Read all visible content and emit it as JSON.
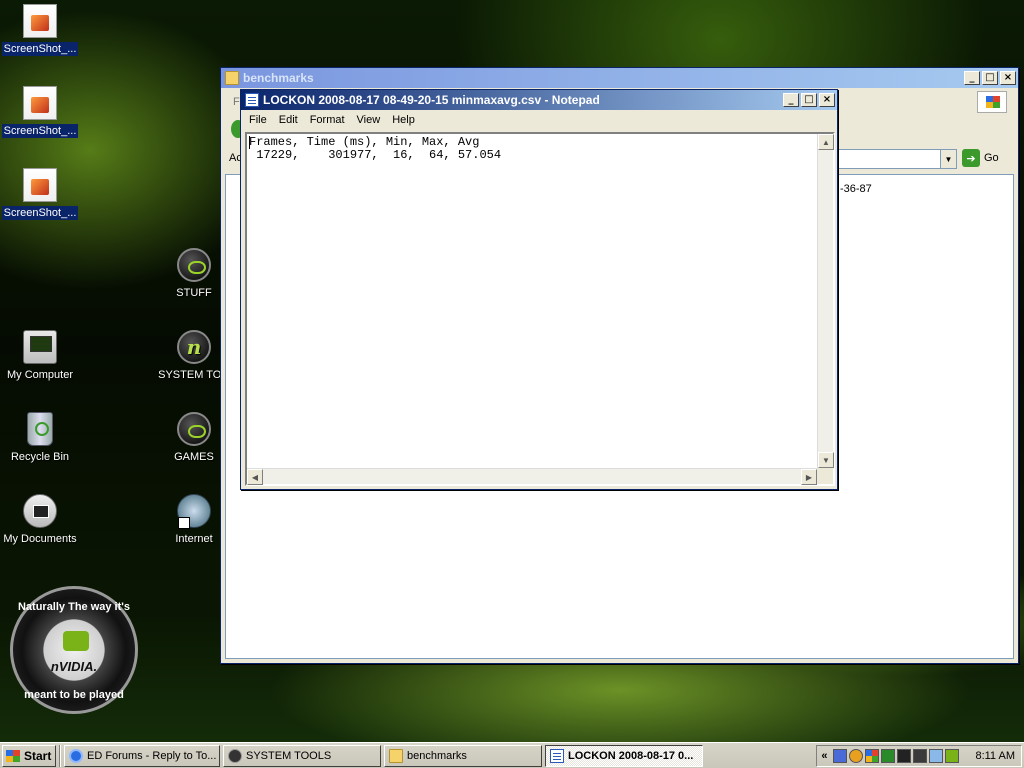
{
  "desktop": {
    "icons_left": [
      {
        "label": "ScreenShot_..."
      },
      {
        "label": "ScreenShot_..."
      },
      {
        "label": "ScreenShot_..."
      },
      {
        "label": "My Computer"
      },
      {
        "label": "Recycle Bin"
      },
      {
        "label": "My Documents"
      }
    ],
    "icons_right": [
      {
        "label": "STUFF"
      },
      {
        "label": "SYSTEM TOO"
      },
      {
        "label": "GAMES"
      },
      {
        "label": "Internet"
      }
    ],
    "badge": {
      "top": "Naturally The way it's",
      "brand": "nVIDIA.",
      "bottom": "meant to be played"
    }
  },
  "explorer": {
    "title": "benchmarks",
    "address_prefix": "Ac",
    "go_label": "Go",
    "file_fragment": "-36-87",
    "menu_fragment": "F"
  },
  "notepad": {
    "title": "LOCKON 2008-08-17 08-49-20-15 minmaxavg.csv - Notepad",
    "menu": [
      "File",
      "Edit",
      "Format",
      "View",
      "Help"
    ],
    "content": "Frames, Time (ms), Min, Max, Avg\n 17229,    301977,  16,  64, 57.054"
  },
  "taskbar": {
    "start": "Start",
    "buttons": [
      {
        "label": "ED Forums - Reply to To...",
        "active": false
      },
      {
        "label": "SYSTEM TOOLS",
        "active": false
      },
      {
        "label": "benchmarks",
        "active": false
      },
      {
        "label": "LOCKON 2008-08-17 0...",
        "active": true
      }
    ],
    "tray_chevron": "«",
    "clock": "8:11 AM"
  }
}
